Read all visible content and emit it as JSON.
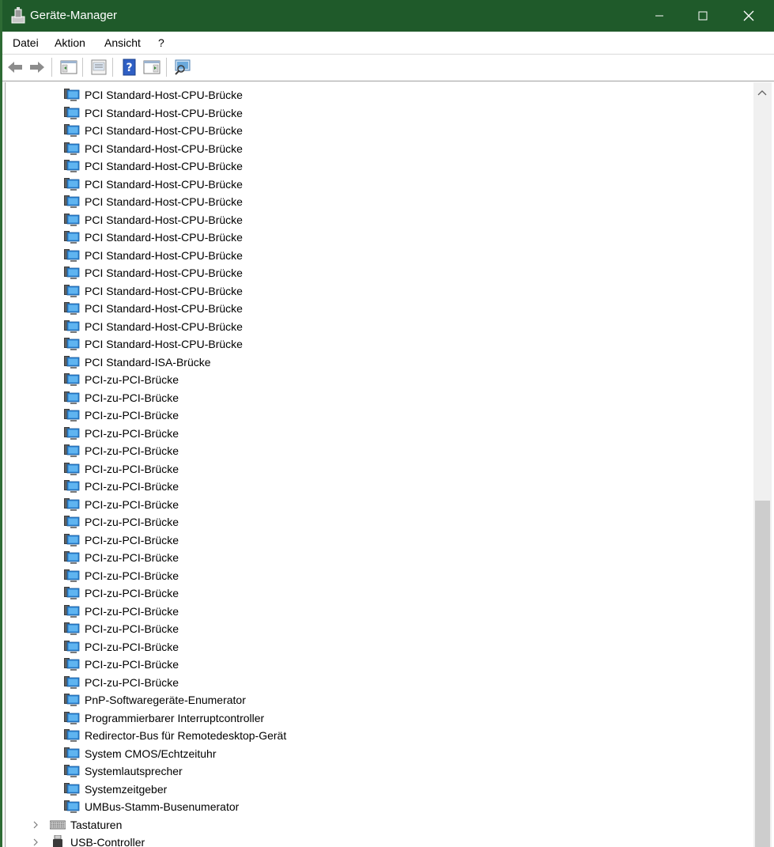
{
  "window": {
    "title": "Geräte-Manager"
  },
  "menu": {
    "items": [
      "Datei",
      "Aktion",
      "Ansicht",
      "?"
    ]
  },
  "toolbar": {
    "buttons": [
      "back-arrow-icon",
      "forward-arrow-icon",
      "show-hide-console-tree-icon",
      "properties-icon",
      "help-icon",
      "show-action-pane-icon",
      "scan-hardware-changes-icon"
    ]
  },
  "tree": {
    "devices": [
      "PCI Standard-Host-CPU-Brücke",
      "PCI Standard-Host-CPU-Brücke",
      "PCI Standard-Host-CPU-Brücke",
      "PCI Standard-Host-CPU-Brücke",
      "PCI Standard-Host-CPU-Brücke",
      "PCI Standard-Host-CPU-Brücke",
      "PCI Standard-Host-CPU-Brücke",
      "PCI Standard-Host-CPU-Brücke",
      "PCI Standard-Host-CPU-Brücke",
      "PCI Standard-Host-CPU-Brücke",
      "PCI Standard-Host-CPU-Brücke",
      "PCI Standard-Host-CPU-Brücke",
      "PCI Standard-Host-CPU-Brücke",
      "PCI Standard-Host-CPU-Brücke",
      "PCI Standard-Host-CPU-Brücke",
      "PCI Standard-ISA-Brücke",
      "PCI-zu-PCI-Brücke",
      "PCI-zu-PCI-Brücke",
      "PCI-zu-PCI-Brücke",
      "PCI-zu-PCI-Brücke",
      "PCI-zu-PCI-Brücke",
      "PCI-zu-PCI-Brücke",
      "PCI-zu-PCI-Brücke",
      "PCI-zu-PCI-Brücke",
      "PCI-zu-PCI-Brücke",
      "PCI-zu-PCI-Brücke",
      "PCI-zu-PCI-Brücke",
      "PCI-zu-PCI-Brücke",
      "PCI-zu-PCI-Brücke",
      "PCI-zu-PCI-Brücke",
      "PCI-zu-PCI-Brücke",
      "PCI-zu-PCI-Brücke",
      "PCI-zu-PCI-Brücke",
      "PCI-zu-PCI-Brücke",
      "PnP-Softwaregeräte-Enumerator",
      "Programmierbarer Interruptcontroller",
      "Redirector-Bus für Remotedesktop-Gerät",
      "System CMOS/Echtzeituhr",
      "Systemlautsprecher",
      "Systemzeitgeber",
      "UMBus-Stamm-Busenumerator"
    ],
    "categories": [
      {
        "label": "Tastaturen",
        "icon": "keyboard-icon"
      },
      {
        "label": "USB-Controller",
        "icon": "usb-icon"
      }
    ]
  }
}
